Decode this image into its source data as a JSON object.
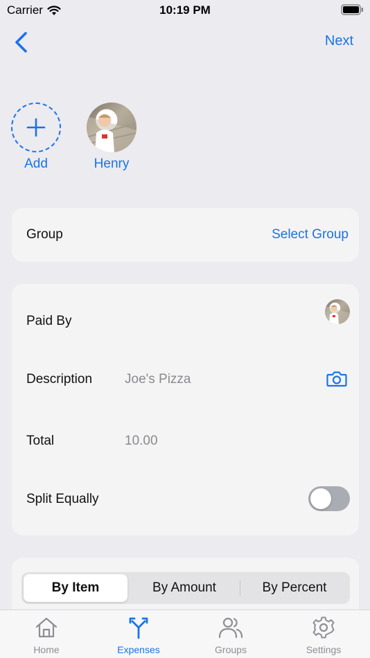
{
  "status_bar": {
    "carrier": "Carrier",
    "time": "10:19 PM"
  },
  "nav": {
    "back_icon": "chevron-left-icon",
    "next_label": "Next"
  },
  "participants": [
    {
      "name": "Add",
      "icon": "plus-icon"
    },
    {
      "name": "Henry",
      "icon": "avatar-photo"
    }
  ],
  "group": {
    "label": "Group",
    "action": "Select Group"
  },
  "details": {
    "paid_by_label": "Paid By",
    "description_label": "Description",
    "description_value": "Joe's Pizza",
    "total_label": "Total",
    "total_value": "10.00",
    "split_equally_label": "Split Equally",
    "split_equally_on": false
  },
  "split_mode": {
    "options": [
      "By Item",
      "By Amount",
      "By Percent"
    ],
    "selected": "By Item"
  },
  "tabbar": {
    "tabs": [
      {
        "label": "Home",
        "icon": "house-icon",
        "active": false
      },
      {
        "label": "Expenses",
        "icon": "split-arrow-icon",
        "active": true
      },
      {
        "label": "Groups",
        "icon": "people-icon",
        "active": false
      },
      {
        "label": "Settings",
        "icon": "gear-icon",
        "active": false
      }
    ]
  },
  "colors": {
    "accent": "#1a73e8",
    "background": "#ebebf0",
    "card": "#f4f4f5"
  }
}
